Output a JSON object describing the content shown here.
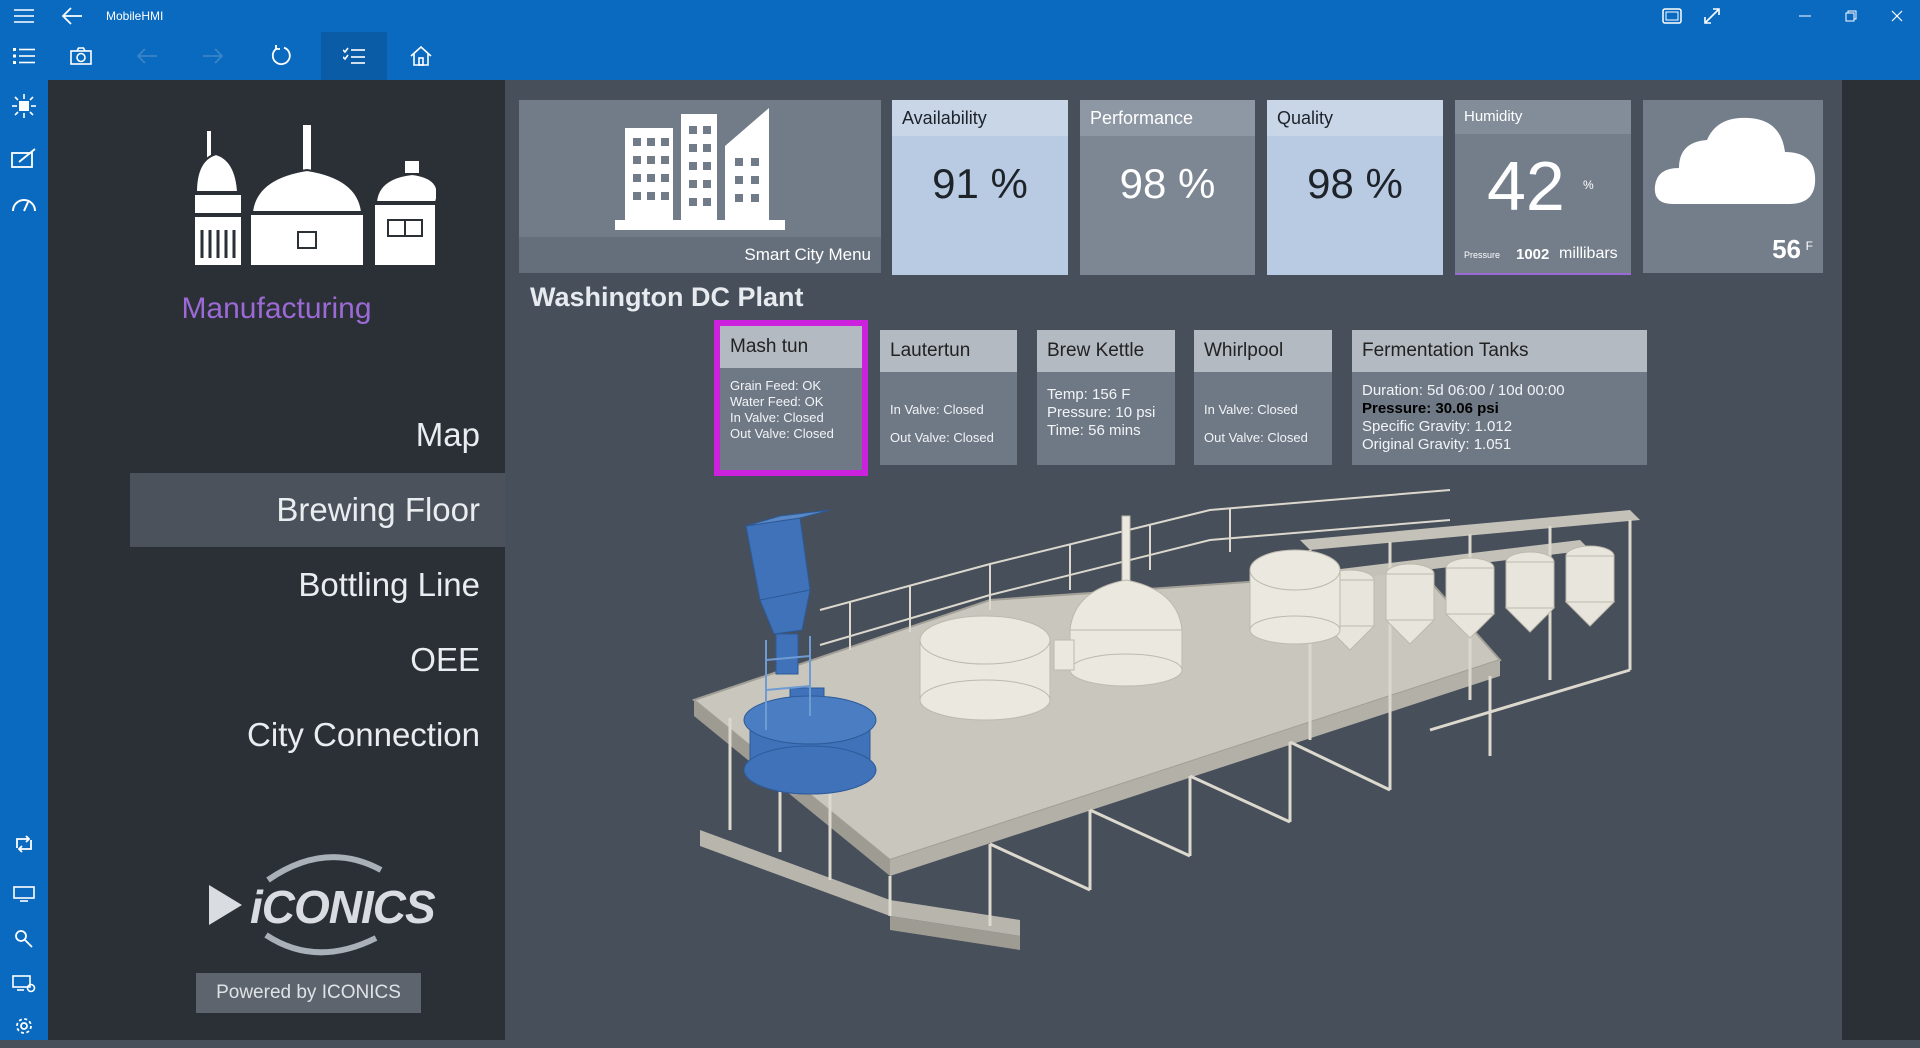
{
  "app": {
    "title": "MobileHMI"
  },
  "toolbar": {
    "buttons": [
      {
        "icon": "camera-icon"
      },
      {
        "icon": "back-arrow-icon"
      },
      {
        "icon": "forward-arrow-icon"
      },
      {
        "icon": "refresh-icon"
      },
      {
        "icon": "checklist-icon"
      },
      {
        "icon": "home-icon"
      }
    ]
  },
  "nav": {
    "category": "Manufacturing",
    "items": [
      {
        "label": "Map"
      },
      {
        "label": "Brewing Floor"
      },
      {
        "label": "Bottling Line"
      },
      {
        "label": "OEE"
      },
      {
        "label": "City Connection"
      }
    ],
    "selected_index": 1,
    "logo_text": "iCONICS",
    "powered_by": "Powered by ICONICS"
  },
  "kpis": {
    "smart_city": {
      "label": "Smart City Menu"
    },
    "availability": {
      "label": "Availability",
      "value": "91 %"
    },
    "performance": {
      "label": "Performance",
      "value": "98 %"
    },
    "quality": {
      "label": "Quality",
      "value": "98 %"
    },
    "humidity": {
      "label": "Humidity",
      "value": "42",
      "unit": "%",
      "pressure_label": "Pressure",
      "pressure_value": "1002",
      "pressure_unit": "millibars"
    },
    "weather": {
      "temp": "56",
      "unit": "F"
    }
  },
  "plant": {
    "title": "Washington DC Plant",
    "cards": {
      "mash_tun": {
        "title": "Mash tun",
        "lines": [
          "Grain Feed: OK",
          "Water Feed: OK",
          "In Valve: Closed",
          "Out Valve: Closed"
        ]
      },
      "lautertun": {
        "title": "Lautertun",
        "lines": [
          "In Valve: Closed",
          "Out Valve: Closed"
        ]
      },
      "brew_kettle": {
        "title": "Brew Kettle",
        "lines": [
          "Temp: 156 F",
          "Pressure: 10 psi",
          "Time: 56 mins"
        ]
      },
      "whirlpool": {
        "title": "Whirlpool",
        "lines": [
          "In Valve: Closed",
          "Out Valve: Closed"
        ]
      },
      "fermentation": {
        "title": "Fermentation Tanks",
        "lines": [
          "Duration: 5d 06:00 / 10d 00:00",
          "Pressure: 30.06 psi",
          "Specific Gravity: 1.012",
          "Original Gravity: 1.051"
        ]
      }
    }
  },
  "colors": {
    "accent": "#0a6abf",
    "nav_title": "#9b6ad6",
    "highlight": "#cc22dd",
    "equipment_active": "#3f72b9"
  }
}
